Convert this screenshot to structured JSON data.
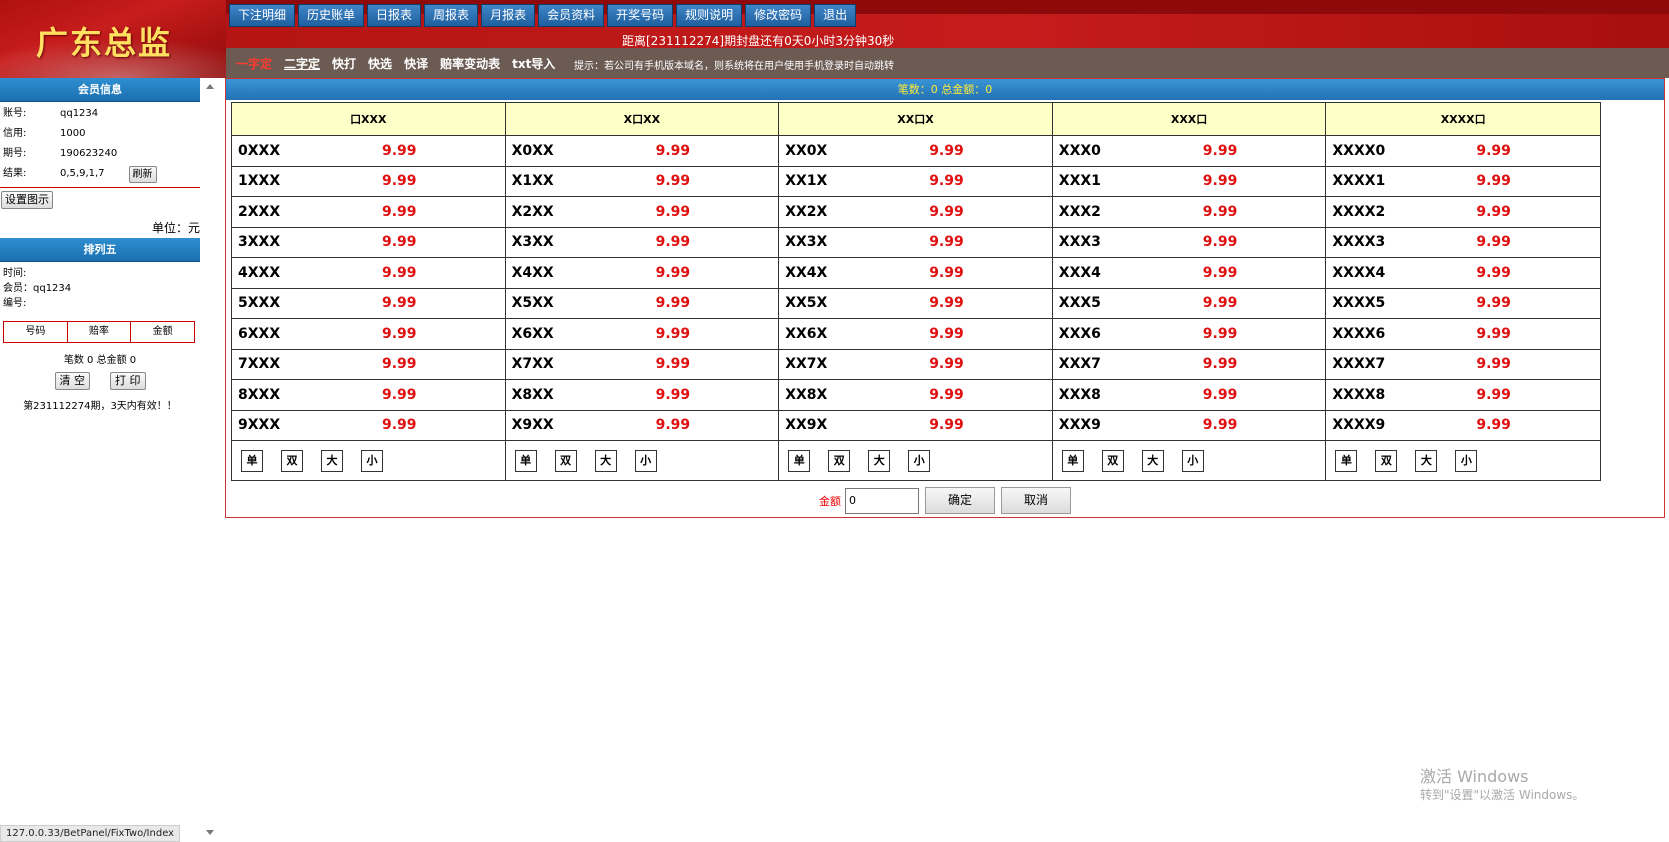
{
  "logo": {
    "text": "广东总监"
  },
  "nav": [
    "下注明细",
    "历史账单",
    "日报表",
    "周报表",
    "月报表",
    "会员资料",
    "开奖号码",
    "规则说明",
    "修改密码",
    "退出"
  ],
  "countdown": "距离[231112274]期封盘还有0天0小时3分钟30秒",
  "subnav": [
    "一字定",
    "二字定",
    "快打",
    "快选",
    "快译",
    "赔率变动表",
    "txt导入"
  ],
  "hint": "提示：若公司有手机版本域名，则系统将在用户使用手机登录时自动跳转",
  "member": {
    "title": "会员信息",
    "rows": [
      {
        "k": "账号:",
        "v": "qq1234"
      },
      {
        "k": "信用:",
        "v": "1000"
      },
      {
        "k": "期号:",
        "v": "190623240"
      },
      {
        "k": "结果:",
        "v": "0,5,9,1,7"
      }
    ],
    "refresh": "刷新",
    "set_display": "设置图示",
    "unit": "单位：元"
  },
  "panel": {
    "title": "排列五",
    "time": "时间:",
    "member": "会员：qq1234",
    "serial": "编号:",
    "headers": [
      "号码",
      "赔率",
      "金额"
    ],
    "summary": "笔数 0 总金额 0",
    "clear": "清 空",
    "print": "打 印",
    "valid": "第231112274期，3天内有效！！"
  },
  "summary_bar": "笔数：0 总金额：0",
  "columns": [
    {
      "head": "口XXX",
      "rows": [
        [
          "0XXX",
          "9.99"
        ],
        [
          "1XXX",
          "9.99"
        ],
        [
          "2XXX",
          "9.99"
        ],
        [
          "3XXX",
          "9.99"
        ],
        [
          "4XXX",
          "9.99"
        ],
        [
          "5XXX",
          "9.99"
        ],
        [
          "6XXX",
          "9.99"
        ],
        [
          "7XXX",
          "9.99"
        ],
        [
          "8XXX",
          "9.99"
        ],
        [
          "9XXX",
          "9.99"
        ]
      ]
    },
    {
      "head": "X口XX",
      "rows": [
        [
          "X0XX",
          "9.99"
        ],
        [
          "X1XX",
          "9.99"
        ],
        [
          "X2XX",
          "9.99"
        ],
        [
          "X3XX",
          "9.99"
        ],
        [
          "X4XX",
          "9.99"
        ],
        [
          "X5XX",
          "9.99"
        ],
        [
          "X6XX",
          "9.99"
        ],
        [
          "X7XX",
          "9.99"
        ],
        [
          "X8XX",
          "9.99"
        ],
        [
          "X9XX",
          "9.99"
        ]
      ]
    },
    {
      "head": "XX口X",
      "rows": [
        [
          "XX0X",
          "9.99"
        ],
        [
          "XX1X",
          "9.99"
        ],
        [
          "XX2X",
          "9.99"
        ],
        [
          "XX3X",
          "9.99"
        ],
        [
          "XX4X",
          "9.99"
        ],
        [
          "XX5X",
          "9.99"
        ],
        [
          "XX6X",
          "9.99"
        ],
        [
          "XX7X",
          "9.99"
        ],
        [
          "XX8X",
          "9.99"
        ],
        [
          "XX9X",
          "9.99"
        ]
      ]
    },
    {
      "head": "XXX口",
      "rows": [
        [
          "XXX0",
          "9.99"
        ],
        [
          "XXX1",
          "9.99"
        ],
        [
          "XXX2",
          "9.99"
        ],
        [
          "XXX3",
          "9.99"
        ],
        [
          "XXX4",
          "9.99"
        ],
        [
          "XXX5",
          "9.99"
        ],
        [
          "XXX6",
          "9.99"
        ],
        [
          "XXX7",
          "9.99"
        ],
        [
          "XXX8",
          "9.99"
        ],
        [
          "XXX9",
          "9.99"
        ]
      ]
    },
    {
      "head": "XXXX口",
      "rows": [
        [
          "XXXX0",
          "9.99"
        ],
        [
          "XXXX1",
          "9.99"
        ],
        [
          "XXXX2",
          "9.99"
        ],
        [
          "XXXX3",
          "9.99"
        ],
        [
          "XXXX4",
          "9.99"
        ],
        [
          "XXXX5",
          "9.99"
        ],
        [
          "XXXX6",
          "9.99"
        ],
        [
          "XXXX7",
          "9.99"
        ],
        [
          "XXXX8",
          "9.99"
        ],
        [
          "XXXX9",
          "9.99"
        ]
      ]
    }
  ],
  "quick_buttons": [
    "单",
    "双",
    "大",
    "小"
  ],
  "amount": {
    "label": "金额",
    "value": "0",
    "confirm": "确定",
    "cancel": "取消"
  },
  "status_url": "127.0.0.33/BetPanel/FixTwo/Index",
  "watermark": {
    "line1": "激活 Windows",
    "line2": "转到\"设置\"以激活 Windows。"
  },
  "colors": {
    "odds": "#e01010",
    "header_bg": "#ffffc8",
    "nav_blue": "#2a6fb0",
    "brand_red": "#c71d1d"
  }
}
